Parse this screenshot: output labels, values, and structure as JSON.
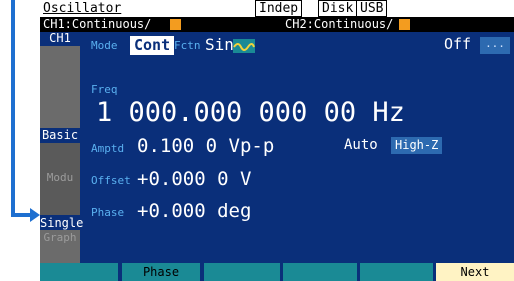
{
  "header": {
    "title": "Oscillator",
    "indicators": [
      "Indep",
      "Disk",
      "USB"
    ]
  },
  "channel_status": {
    "ch1": "CH1:Continuous/",
    "ch2": "CH2:Continuous/"
  },
  "side_menu": {
    "channel_tab": "CH1",
    "items": [
      "Basic",
      "Modu",
      "Single",
      "Graph"
    ],
    "callout_target": "Single"
  },
  "settings": {
    "mode_label": "Mode",
    "mode_value": "Cont",
    "function_label": "Fctn",
    "function_value": "Sine",
    "output_state": "Off",
    "more_label": "...",
    "freq_label": "Freq",
    "freq_value": "1 000.000 000 00 Hz",
    "amptd_label": "Amptd",
    "amptd_value": "0.100 0 Vp-p",
    "range_value": "Auto",
    "load_value": "High-Z",
    "offset_label": "Offset",
    "offset_value": "+0.000 0 V",
    "phase_label": "Phase",
    "phase_value": "+0.000 deg"
  },
  "softkeys": [
    "",
    "Phase",
    "",
    "",
    "",
    "Next"
  ],
  "colors": {
    "screen_bg": "#0a2f7a",
    "label_blue": "#5ab0f0",
    "softkey_teal": "#1a8a95",
    "accent_orange": "#f39c1f",
    "callout_arrow": "#1e6fd0"
  }
}
